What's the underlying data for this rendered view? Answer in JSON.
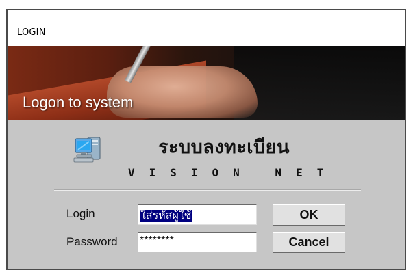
{
  "window": {
    "title": "LOGIN"
  },
  "banner": {
    "text": "Logon to system"
  },
  "app": {
    "icon": "computer-icon",
    "title_th": "ระบบลงทะเบียน",
    "title_en": "VISION NET"
  },
  "form": {
    "login_label": "Login",
    "login_value": "ใส่รหัสผู้ใช้",
    "password_label": "Password",
    "password_value": "********",
    "ok_label": "OK",
    "cancel_label": "Cancel"
  },
  "colors": {
    "dialog_bg": "#c6c6c6",
    "selection_bg": "#000080"
  }
}
